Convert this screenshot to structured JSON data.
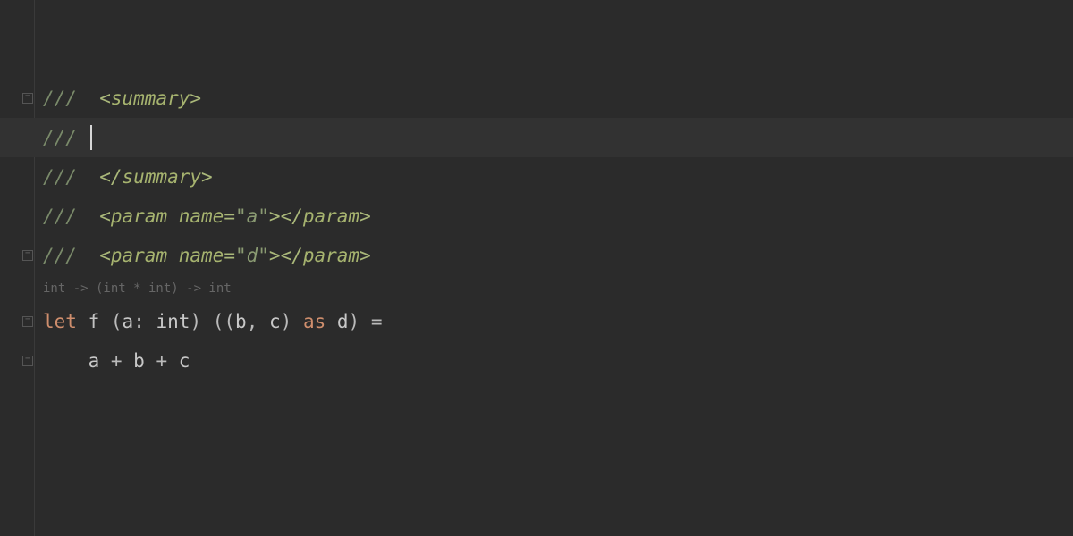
{
  "code": {
    "lines": [
      {
        "fold": true,
        "parts": [
          {
            "t": "/// ",
            "cls": "comment-slash"
          },
          {
            "t": " <",
            "cls": "xml-punct"
          },
          {
            "t": "summary",
            "cls": "xml-tag"
          },
          {
            "t": ">",
            "cls": "xml-punct"
          }
        ]
      },
      {
        "highlighted": true,
        "cursor": true,
        "parts": [
          {
            "t": "/// ",
            "cls": "comment-slash"
          }
        ]
      },
      {
        "parts": [
          {
            "t": "/// ",
            "cls": "comment-slash"
          },
          {
            "t": " </",
            "cls": "xml-punct"
          },
          {
            "t": "summary",
            "cls": "xml-tag"
          },
          {
            "t": ">",
            "cls": "xml-punct"
          }
        ]
      },
      {
        "parts": [
          {
            "t": "/// ",
            "cls": "comment-slash"
          },
          {
            "t": " <",
            "cls": "xml-punct"
          },
          {
            "t": "param",
            "cls": "xml-tag"
          },
          {
            "t": " ",
            "cls": "xml-tag"
          },
          {
            "t": "name",
            "cls": "xml-attr"
          },
          {
            "t": "=",
            "cls": "xml-punct"
          },
          {
            "t": "\"a\"",
            "cls": "xml-attr-value"
          },
          {
            "t": "></",
            "cls": "xml-punct"
          },
          {
            "t": "param",
            "cls": "xml-tag"
          },
          {
            "t": ">",
            "cls": "xml-punct"
          }
        ]
      },
      {
        "fold": true,
        "parts": [
          {
            "t": "/// ",
            "cls": "comment-slash"
          },
          {
            "t": " <",
            "cls": "xml-punct"
          },
          {
            "t": "param",
            "cls": "xml-tag"
          },
          {
            "t": " ",
            "cls": "xml-tag"
          },
          {
            "t": "name",
            "cls": "xml-attr"
          },
          {
            "t": "=",
            "cls": "xml-punct"
          },
          {
            "t": "\"d\"",
            "cls": "xml-attr-value"
          },
          {
            "t": "></",
            "cls": "xml-punct"
          },
          {
            "t": "param",
            "cls": "xml-tag"
          },
          {
            "t": ">",
            "cls": "xml-punct"
          }
        ]
      }
    ],
    "hint": "int -> (int * int) -> int",
    "codeLines": [
      {
        "fold": true,
        "parts": [
          {
            "t": "let",
            "cls": "keyword"
          },
          {
            "t": " ",
            "cls": "ident"
          },
          {
            "t": "f",
            "cls": "funcname"
          },
          {
            "t": " (",
            "cls": "punct"
          },
          {
            "t": "a",
            "cls": "ident"
          },
          {
            "t": ":",
            "cls": "punct"
          },
          {
            "t": " ",
            "cls": "ident"
          },
          {
            "t": "int",
            "cls": "type"
          },
          {
            "t": ") ((",
            "cls": "punct"
          },
          {
            "t": "b",
            "cls": "ident"
          },
          {
            "t": ", ",
            "cls": "punct"
          },
          {
            "t": "c",
            "cls": "ident"
          },
          {
            "t": ") ",
            "cls": "punct"
          },
          {
            "t": "as",
            "cls": "keyword"
          },
          {
            "t": " ",
            "cls": "ident"
          },
          {
            "t": "d",
            "cls": "ident"
          },
          {
            "t": ") =",
            "cls": "punct"
          }
        ]
      },
      {
        "fold": true,
        "parts": [
          {
            "t": "    ",
            "cls": "ident"
          },
          {
            "t": "a",
            "cls": "ident"
          },
          {
            "t": " + ",
            "cls": "op"
          },
          {
            "t": "b",
            "cls": "ident"
          },
          {
            "t": " + ",
            "cls": "op"
          },
          {
            "t": "c",
            "cls": "ident"
          }
        ]
      }
    ]
  }
}
